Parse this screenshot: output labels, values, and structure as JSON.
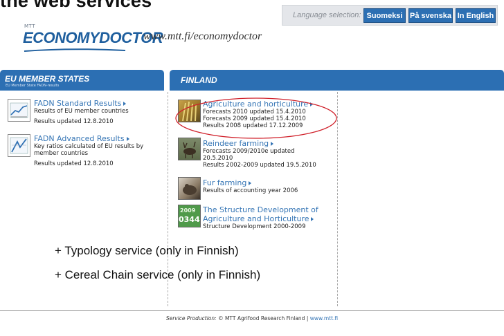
{
  "slide_title": "the web services",
  "language": {
    "label": "Language selection:",
    "buttons": [
      "Suomeksi",
      "På svenska",
      "In English"
    ]
  },
  "logo": {
    "small": "MTT",
    "main": "ECONOMYDOCTOR"
  },
  "site_url": "www.mtt.fi/economydoctor",
  "eu_panel": {
    "title": "EU MEMBER STATES",
    "subtitle": "EU Member State FADN-results",
    "items": [
      {
        "link": "FADN Standard Results",
        "desc": [
          "Results of EU member countries"
        ],
        "updated": "Results updated 12.8.2010",
        "icon": "line-chart-icon"
      },
      {
        "link": "FADN Advanced Results",
        "desc": [
          "Key ratios calculated of EU results by",
          "member countries"
        ],
        "updated": "Results updated 12.8.2010",
        "icon": "advanced-chart-icon"
      }
    ]
  },
  "finland_panel": {
    "title": "FINLAND",
    "items": [
      {
        "link": "Agriculture and horticulture",
        "desc": [
          "Forecasts 2010 updated 15.4.2010",
          "Forecasts 2009 updated 15.4.2010",
          "Results 2008 updated 17.12.2009"
        ]
      },
      {
        "link": "Reindeer farming",
        "desc": [
          "Forecasts 2009/2010e updated",
          "20.5.2010",
          "Results 2002-2009 updated 19.5.2010"
        ]
      },
      {
        "link": "Fur farming",
        "desc": [
          "Results of accounting year 2006"
        ]
      },
      {
        "link_lines": [
          "The Structure Development of",
          "Agriculture and Horticulture"
        ],
        "desc": [
          "Structure Development 2000-2009"
        ]
      }
    ]
  },
  "notes": [
    "+ Typology service (only in Finnish)",
    "+ Cereal Chain service (only in Finnish)"
  ],
  "footer": {
    "label": "Service Production:",
    "text": "© MTT Agrifood Research Finland |",
    "link": "www.mtt.fi"
  },
  "colors": {
    "primary": "#2c6fb3",
    "link": "#3575b5",
    "highlight": "#d0202a"
  }
}
